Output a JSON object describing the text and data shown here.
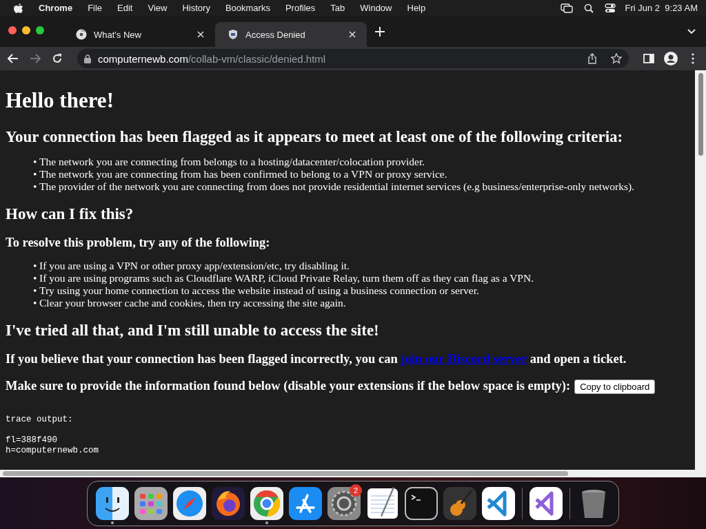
{
  "menu_bar": {
    "app": "Chrome",
    "items": [
      "File",
      "Edit",
      "View",
      "History",
      "Bookmarks",
      "Profiles",
      "Tab",
      "Window",
      "Help"
    ],
    "clock": "Fri Jun 2  9:23 AM"
  },
  "tabs": [
    {
      "title": "What's New",
      "selected": false,
      "kind": "chrome"
    },
    {
      "title": "Access Denied",
      "selected": true,
      "kind": "shield"
    }
  ],
  "address_bar": {
    "host": "computernewb.com",
    "path": "/collab-vm/classic/denied.html"
  },
  "content": [
    {
      "kind": "h1",
      "text": "Hello there!"
    },
    {
      "kind": "h2",
      "text": "Your connection has been flagged as it appears to meet at least one of the following criteria:"
    },
    {
      "kind": "list",
      "marker": "•",
      "items": [
        "The network you are connecting from belongs to a hosting/datacenter/colocation provider.",
        "The network you are connecting from has been confirmed to belong to a VPN or proxy service.",
        "The provider of the network you are connecting from does not provide residential internet services (e.g business/enterprise-only networks)."
      ]
    },
    {
      "kind": "h2",
      "text": "How can I fix this?"
    },
    {
      "kind": "h3",
      "text": "To resolve this problem, try any of the following:"
    },
    {
      "kind": "list",
      "marker": "•",
      "items": [
        "If you are using a VPN or other proxy app/extension/etc, try disabling it.",
        "If you are using programs such as Cloudflare WARP, iCloud Private Relay, turn them off as they can flag as a VPN.",
        "Try using your home connection to access the website instead of using a business connection or server.",
        "Clear your browser cache and cookies, then try accessing the site again."
      ]
    },
    {
      "kind": "h2",
      "text": "I've tried all that, and I'm still unable to access the site!"
    },
    {
      "kind": "link_line",
      "before": "If you believe that your connection has been flagged incorrectly, you can",
      "link": "join our Discord server",
      "after": "and open a ticket."
    },
    {
      "kind": "button_line",
      "text": "Make sure to provide the information found below (disable your extensions if the below space is empty):",
      "button": "Copy to clipboard"
    },
    {
      "kind": "pre",
      "header": "trace output:",
      "lines": [
        "fl=388f490",
        "h=computernewb.com"
      ]
    }
  ],
  "dock": [
    {
      "kind": "finder",
      "running": true
    },
    {
      "kind": "launchpad",
      "running": false
    },
    {
      "kind": "compass",
      "running": false
    },
    {
      "kind": "fox",
      "running": false
    },
    {
      "kind": "chrome",
      "running": true
    },
    {
      "kind": "store",
      "running": false
    },
    {
      "kind": "gear",
      "running": false,
      "badge": "2"
    },
    {
      "kind": "notepad",
      "running": false
    },
    {
      "kind": "terminal",
      "running": false
    },
    {
      "kind": "guitar",
      "running": false
    },
    {
      "kind": "code",
      "running": false
    },
    {
      "kind": "sep"
    },
    {
      "kind": "code2",
      "running": false
    },
    {
      "kind": "sep"
    },
    {
      "kind": "trash",
      "running": false
    }
  ]
}
